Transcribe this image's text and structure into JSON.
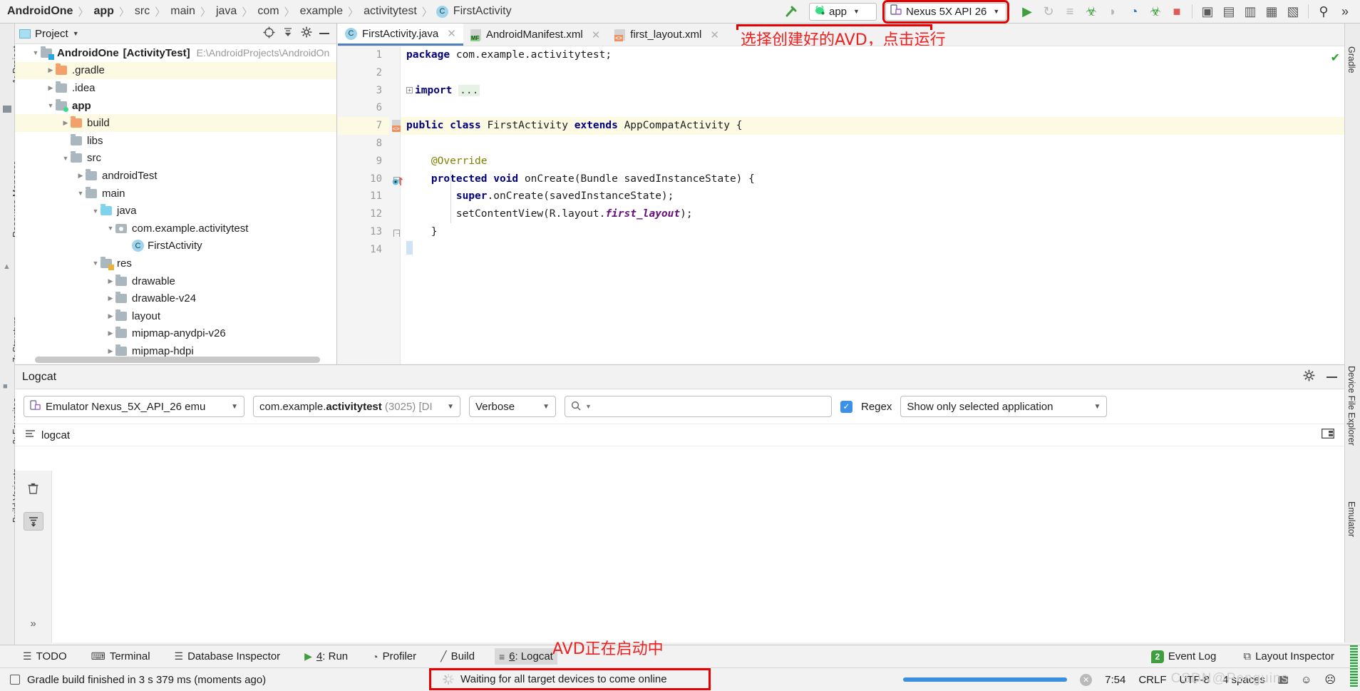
{
  "toolbar": {
    "breadcrumb": [
      "AndroidOne",
      "app",
      "src",
      "main",
      "java",
      "com",
      "example",
      "activitytest",
      "FirstActivity"
    ],
    "class_chip": "C",
    "build_hammer_icon": "hammer-icon",
    "run_config": {
      "label": "app",
      "icon": "android-robot-icon"
    },
    "device_selector": {
      "label": "Nexus 5X API 26",
      "icon": "device-phone-icon",
      "highlight_color": "#e60000"
    },
    "actions": [
      {
        "name": "run-button",
        "glyph": "▶",
        "color": "#3f9f3f"
      },
      {
        "name": "apply-changes-icon",
        "glyph": "↻",
        "color": "#b6b6b6"
      },
      {
        "name": "apply-code-changes-icon",
        "glyph": "≡",
        "color": "#b6b6b6"
      },
      {
        "name": "debug-button",
        "glyph": "☣",
        "color": "#3f9f3f"
      },
      {
        "name": "attach-debugger-icon",
        "glyph": "◗",
        "color": "#b6b6b6"
      },
      {
        "name": "profiler-button",
        "glyph": "◔",
        "color": "#2a7bc0"
      },
      {
        "name": "run-with-coverage-icon",
        "glyph": "☣",
        "color": "#3f9f3f"
      },
      {
        "name": "stop-button",
        "glyph": "■",
        "color": "#e05a5a"
      },
      {
        "name": "avd-manager-icon",
        "glyph": "▣",
        "color": "#5a5a5a"
      },
      {
        "name": "sdk-manager-icon",
        "glyph": "▤",
        "color": "#5a5a5a"
      },
      {
        "name": "device-file-explorer-icon",
        "glyph": "▥",
        "color": "#5a5a5a"
      },
      {
        "name": "layout-inspector-icon",
        "glyph": "▦",
        "color": "#5a5a5a"
      },
      {
        "name": "project-structure-icon",
        "glyph": "▧",
        "color": "#5a5a5a"
      },
      {
        "name": "search-everywhere-icon",
        "glyph": "⚲",
        "color": "#3c3c3c"
      },
      {
        "name": "overflow-icon",
        "glyph": "»",
        "color": "#3c3c3c"
      }
    ]
  },
  "left_rail": [
    "1: Project",
    "Resource Manager",
    "7: Structure",
    "2: Favorites"
  ],
  "right_rail": [
    "Gradle",
    "Device File Explorer",
    "Emulator"
  ],
  "left_rail_bottom": [
    "Build Variants"
  ],
  "project_panel": {
    "title": "Project",
    "title_caret": "▼",
    "header_icons": [
      "target-locate-icon",
      "collapse-all-icon",
      "settings-gear-icon",
      "minimize-icon"
    ],
    "tree": [
      {
        "indent": 0,
        "arrow": "▼",
        "icon": "module-folder",
        "name": "AndroidOne",
        "suffix": "[ActivityTest]",
        "path": "E:\\AndroidProjects\\AndroidOn",
        "bold": true,
        "highlight": false
      },
      {
        "indent": 1,
        "arrow": "▶",
        "icon": "orange-folder",
        "name": ".gradle",
        "suffix": "",
        "path": "",
        "bold": false,
        "highlight": true
      },
      {
        "indent": 1,
        "arrow": "▶",
        "icon": "gray-folder",
        "name": ".idea",
        "suffix": "",
        "path": "",
        "bold": false,
        "highlight": false
      },
      {
        "indent": 1,
        "arrow": "▼",
        "icon": "module-folder",
        "name": "app",
        "suffix": "",
        "path": "",
        "bold": true,
        "highlight": false
      },
      {
        "indent": 2,
        "arrow": "▶",
        "icon": "orange-folder",
        "name": "build",
        "suffix": "",
        "path": "",
        "bold": false,
        "highlight": true
      },
      {
        "indent": 2,
        "arrow": "",
        "icon": "gray-folder",
        "name": "libs",
        "suffix": "",
        "path": "",
        "bold": false,
        "highlight": false
      },
      {
        "indent": 2,
        "arrow": "▼",
        "icon": "gray-folder",
        "name": "src",
        "suffix": "",
        "path": "",
        "bold": false,
        "highlight": false
      },
      {
        "indent": 3,
        "arrow": "▶",
        "icon": "gray-folder",
        "name": "androidTest",
        "suffix": "",
        "path": "",
        "bold": false,
        "highlight": false
      },
      {
        "indent": 3,
        "arrow": "▼",
        "icon": "gray-folder",
        "name": "main",
        "suffix": "",
        "path": "",
        "bold": false,
        "highlight": false
      },
      {
        "indent": 4,
        "arrow": "▼",
        "icon": "blue-folder",
        "name": "java",
        "suffix": "",
        "path": "",
        "bold": false,
        "highlight": false
      },
      {
        "indent": 5,
        "arrow": "▼",
        "icon": "package-folder",
        "name": "com.example.activitytest",
        "suffix": "",
        "path": "",
        "bold": false,
        "highlight": false
      },
      {
        "indent": 6,
        "arrow": "",
        "icon": "class-chip",
        "name": "FirstActivity",
        "suffix": "",
        "path": "",
        "bold": false,
        "highlight": false
      },
      {
        "indent": 4,
        "arrow": "▼",
        "icon": "res-folder",
        "name": "res",
        "suffix": "",
        "path": "",
        "bold": false,
        "highlight": false
      },
      {
        "indent": 5,
        "arrow": "▶",
        "icon": "gray-folder",
        "name": "drawable",
        "suffix": "",
        "path": "",
        "bold": false,
        "highlight": false
      },
      {
        "indent": 5,
        "arrow": "▶",
        "icon": "gray-folder",
        "name": "drawable-v24",
        "suffix": "",
        "path": "",
        "bold": false,
        "highlight": false
      },
      {
        "indent": 5,
        "arrow": "▶",
        "icon": "gray-folder",
        "name": "layout",
        "suffix": "",
        "path": "",
        "bold": false,
        "highlight": false
      },
      {
        "indent": 5,
        "arrow": "▶",
        "icon": "gray-folder",
        "name": "mipmap-anydpi-v26",
        "suffix": "",
        "path": "",
        "bold": false,
        "highlight": false
      },
      {
        "indent": 5,
        "arrow": "▶",
        "icon": "gray-folder",
        "name": "mipmap-hdpi",
        "suffix": "",
        "path": "",
        "bold": false,
        "highlight": false
      }
    ]
  },
  "editor": {
    "tabs": [
      {
        "label": "FirstActivity.java",
        "icon": "java-class-icon",
        "active": true,
        "close": "✕"
      },
      {
        "label": "AndroidManifest.xml",
        "icon": "manifest-file-icon",
        "active": false,
        "close": "✕"
      },
      {
        "label": "first_layout.xml",
        "icon": "xml-layout-file-icon",
        "active": false,
        "close": "✕"
      }
    ],
    "annotation_top": "选择创建好的AVD，点击运行",
    "inspection_ok_glyph": "✔",
    "lines": [
      {
        "no": "1",
        "highlight": false,
        "html": "<span class=\"kw\">package</span> <span class=\"plain\">com.example.activitytest;</span>"
      },
      {
        "no": "2",
        "highlight": false,
        "html": ""
      },
      {
        "no": "3",
        "highlight": false,
        "html": "<span class=\"fold-plus\">+</span><span class=\"kw\">import</span> <span class=\"impdots\">...</span>"
      },
      {
        "no": "6",
        "highlight": false,
        "html": ""
      },
      {
        "no": "7",
        "highlight": true,
        "html": "<span class=\"kw\">public class</span> <span class=\"plain\">FirstActivity </span><span class=\"kw\">extends</span> <span class=\"plain\">AppCompatActivity {</span>"
      },
      {
        "no": "8",
        "highlight": false,
        "html": ""
      },
      {
        "no": "9",
        "highlight": false,
        "html": "    <span class=\"ann\">@Override</span>"
      },
      {
        "no": "10",
        "highlight": false,
        "html": "    <span class=\"kw\">protected void</span> <span class=\"plain\">onCreate(Bundle savedInstanceState) {</span>"
      },
      {
        "no": "11",
        "highlight": false,
        "html": "        <span class=\"kw\">super</span><span class=\"plain\">.onCreate(savedInstanceState);</span>"
      },
      {
        "no": "12",
        "highlight": false,
        "html": "        <span class=\"plain\">setContentView(R.layout.</span><span class=\"fld\">first_layout</span><span class=\"plain\">);</span>"
      },
      {
        "no": "13",
        "highlight": false,
        "html": "    <span class=\"plain\">}</span>"
      },
      {
        "no": "14",
        "highlight": false,
        "html": "<span class=\"plain\">}</span>"
      }
    ]
  },
  "logcat": {
    "title": "Logcat",
    "header_icons": [
      "settings-gear-icon",
      "minimize-icon"
    ],
    "device_selector": "Emulator Nexus_5X_API_26 emu",
    "device_selector_suffix": "emu",
    "process_selector_prefix": "com.example.",
    "process_selector_bold": "activitytest",
    "process_selector_suffix": "(3025) [DI",
    "level_selector": "Verbose",
    "search_placeholder": "",
    "search_icon": "search-icon",
    "regex_label": "Regex",
    "regex_checked": true,
    "filter_selector": "Show only selected application",
    "sub_tab": "logcat",
    "rail_buttons": [
      "clear-logcat-icon",
      "scroll-to-end-icon",
      "expand-icon"
    ],
    "entries": []
  },
  "tool_windows": {
    "items": [
      {
        "label": "TODO",
        "icon": "todo-icon",
        "active": false,
        "underline": ""
      },
      {
        "label": "Terminal",
        "icon": "terminal-icon",
        "active": false,
        "underline": ""
      },
      {
        "label": "Database Inspector",
        "icon": "database-icon",
        "active": false,
        "underline": ""
      },
      {
        "label": "4: Run",
        "icon": "run-icon",
        "active": false,
        "underline": "4"
      },
      {
        "label": "Profiler",
        "icon": "profiler-icon",
        "active": false,
        "underline": ""
      },
      {
        "label": "Build",
        "icon": "build-hammer-icon",
        "active": false,
        "underline": ""
      },
      {
        "label": "6: Logcat",
        "icon": "logcat-icon",
        "active": true,
        "underline": "6"
      }
    ],
    "right_items": [
      {
        "label": "Event Log",
        "icon": "event-log-icon",
        "badge": "2"
      },
      {
        "label": "Layout Inspector",
        "icon": "layout-inspector-icon",
        "badge": ""
      }
    ]
  },
  "status_bar": {
    "left_icon": "memory-icon",
    "message": "Gradle build finished in 3 s 379 ms (moments ago)",
    "waiting_message": "Waiting for all target devices to come online",
    "waiting_spinner": "loading-spinner-icon",
    "cancel_icon": "cancel-icon",
    "time": "7:54",
    "line_separator": "CRLF",
    "encoding": "UTF-8",
    "indent": "4 spaces",
    "lock_icon": "unlocked-icon",
    "faces": [
      "😊",
      "😟"
    ],
    "watermark": "CSDN@Penguins",
    "annotation_avd": "AVD正在启动中"
  }
}
